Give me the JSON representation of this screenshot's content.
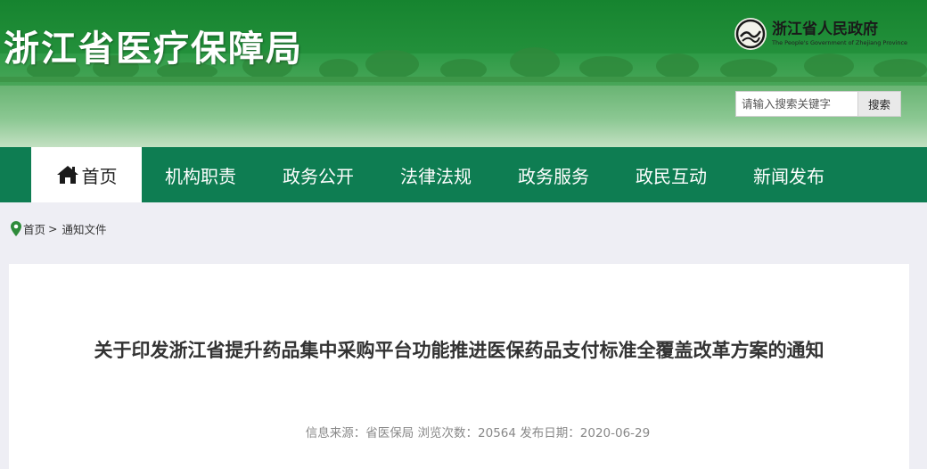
{
  "header": {
    "site_title": "浙江省医疗保障局",
    "gov_logo_cn": "浙江省人民政府",
    "gov_logo_en": "The People's Government of Zhejiang Province"
  },
  "search": {
    "placeholder": "请输入搜索关键字",
    "button_label": "搜索"
  },
  "nav": {
    "items": [
      {
        "label": "首页",
        "icon": "home-icon",
        "active": true
      },
      {
        "label": "机构职责"
      },
      {
        "label": "政务公开"
      },
      {
        "label": "法律法规"
      },
      {
        "label": "政务服务"
      },
      {
        "label": "政民互动"
      },
      {
        "label": "新闻发布"
      }
    ]
  },
  "breadcrumb": {
    "icon": "location-pin-icon",
    "home": "首页",
    "separator": ">",
    "current": "通知文件"
  },
  "article": {
    "title": "关于印发浙江省提升药品集中采购平台功能推进医保药品支付标准全覆盖改革方案的通知",
    "meta": "信息来源：省医保局 浏览次数：20564 发布日期：2020-06-29"
  },
  "colors": {
    "nav_bg": "#0e7d52",
    "banner_green": "#1f8a3a",
    "page_bg": "#eeeef4",
    "pin_green": "#2e8b3a"
  }
}
